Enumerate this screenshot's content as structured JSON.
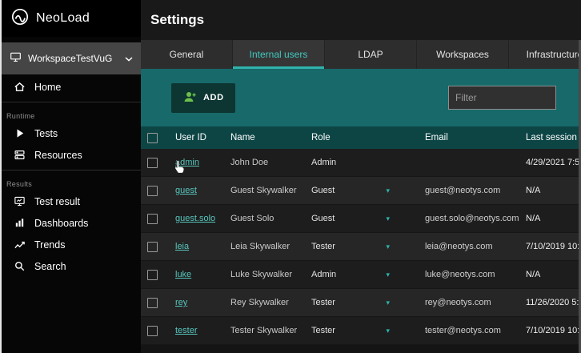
{
  "sidebar": {
    "logo": "NeoLoad",
    "workspace": "WorkspaceTestVuG",
    "nav": [
      {
        "section": null,
        "items": [
          {
            "label": "Home",
            "icon": "home"
          }
        ]
      },
      {
        "section": "Runtime",
        "items": [
          {
            "label": "Tests",
            "icon": "play"
          },
          {
            "label": "Resources",
            "icon": "server"
          }
        ]
      },
      {
        "section": "Results",
        "items": [
          {
            "label": "Test result",
            "icon": "monitor"
          },
          {
            "label": "Dashboards",
            "icon": "bar-chart"
          },
          {
            "label": "Trends",
            "icon": "trend"
          },
          {
            "label": "Search",
            "icon": "search"
          }
        ]
      }
    ]
  },
  "header": {
    "title": "Settings"
  },
  "tabs": [
    {
      "label": "General",
      "active": false
    },
    {
      "label": "Internal users",
      "active": true
    },
    {
      "label": "LDAP",
      "active": false
    },
    {
      "label": "Workspaces",
      "active": false
    },
    {
      "label": "Infrastructure",
      "active": false
    }
  ],
  "toolbar": {
    "add_label": "ADD",
    "filter_placeholder": "Filter"
  },
  "table": {
    "columns": [
      "User ID",
      "Name",
      "Role",
      "Email",
      "Last session"
    ],
    "rows": [
      {
        "user_id": "admin",
        "name": "John Doe",
        "role": "Admin",
        "email": "",
        "last_session": "4/29/2021 7:5",
        "role_dropdown": false
      },
      {
        "user_id": "guest",
        "name": "Guest Skywalker",
        "role": "Guest",
        "email": "guest@neotys.com",
        "last_session": "N/A",
        "role_dropdown": true
      },
      {
        "user_id": "guest.solo",
        "name": "Guest Solo",
        "role": "Guest",
        "email": "guest.solo@neotys.com",
        "last_session": "N/A",
        "role_dropdown": true
      },
      {
        "user_id": "leia",
        "name": "Leia Skywalker",
        "role": "Tester",
        "email": "leia@neotys.com",
        "last_session": "7/10/2019 10:",
        "role_dropdown": true
      },
      {
        "user_id": "luke",
        "name": "Luke Skywalker",
        "role": "Admin",
        "email": "luke@neotys.com",
        "last_session": "N/A",
        "role_dropdown": true
      },
      {
        "user_id": "rey",
        "name": "Rey Skywalker",
        "role": "Tester",
        "email": "rey@neotys.com",
        "last_session": "11/26/2020 5:",
        "role_dropdown": true
      },
      {
        "user_id": "tester",
        "name": "Tester Skywalker",
        "role": "Tester",
        "email": "tester@neotys.com",
        "last_session": "7/10/2019 10:",
        "role_dropdown": true
      }
    ]
  },
  "colors": {
    "accent_teal": "#2fb3ab",
    "toolbar_bg": "#17696a",
    "table_header_bg": "#0d4545",
    "link_teal": "#58c6bd",
    "add_icon_green": "#6cc04a"
  }
}
